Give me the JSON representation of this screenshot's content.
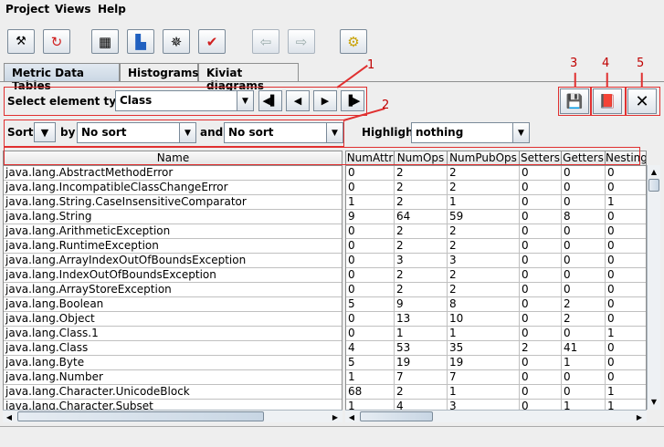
{
  "menu": {
    "items": [
      "Project",
      "Views",
      "Help"
    ]
  },
  "tabs": [
    "Metric Data Tables",
    "Histograms",
    "Kiviat diagrams"
  ],
  "select": {
    "label": "Select element type",
    "value": "Class"
  },
  "sort": {
    "label": "Sort",
    "by_label": "by",
    "and_label": "and",
    "primary": "No sort",
    "secondary": "No sort"
  },
  "highlight": {
    "label": "Highlight",
    "value": "nothing"
  },
  "annotations": [
    "1",
    "2",
    "3",
    "4",
    "5"
  ],
  "left_table": {
    "header": "Name",
    "rows": [
      "java.lang.AbstractMethodError",
      "java.lang.IncompatibleClassChangeError",
      "java.lang.String.CaseInsensitiveComparator",
      "java.lang.String",
      "java.lang.ArithmeticException",
      "java.lang.RuntimeException",
      "java.lang.ArrayIndexOutOfBoundsException",
      "java.lang.IndexOutOfBoundsException",
      "java.lang.ArrayStoreException",
      "java.lang.Boolean",
      "java.lang.Object",
      "java.lang.Class.1",
      "java.lang.Class",
      "java.lang.Byte",
      "java.lang.Number",
      "java.lang.Character.UnicodeBlock",
      "java.lang.Character.Subset"
    ]
  },
  "right_table": {
    "columns": [
      "NumAttr",
      "NumOps",
      "NumPubOps",
      "Setters",
      "Getters",
      "Nesting"
    ],
    "rows": [
      [
        "0",
        "2",
        "2",
        "0",
        "0",
        "0"
      ],
      [
        "0",
        "2",
        "2",
        "0",
        "0",
        "0"
      ],
      [
        "1",
        "2",
        "1",
        "0",
        "0",
        "1"
      ],
      [
        "9",
        "64",
        "59",
        "0",
        "8",
        "0"
      ],
      [
        "0",
        "2",
        "2",
        "0",
        "0",
        "0"
      ],
      [
        "0",
        "2",
        "2",
        "0",
        "0",
        "0"
      ],
      [
        "0",
        "3",
        "3",
        "0",
        "0",
        "0"
      ],
      [
        "0",
        "2",
        "2",
        "0",
        "0",
        "0"
      ],
      [
        "0",
        "2",
        "2",
        "0",
        "0",
        "0"
      ],
      [
        "5",
        "9",
        "8",
        "0",
        "2",
        "0"
      ],
      [
        "0",
        "13",
        "10",
        "0",
        "2",
        "0"
      ],
      [
        "0",
        "1",
        "1",
        "0",
        "0",
        "1"
      ],
      [
        "4",
        "53",
        "35",
        "2",
        "41",
        "0"
      ],
      [
        "5",
        "19",
        "19",
        "0",
        "1",
        "0"
      ],
      [
        "1",
        "7",
        "7",
        "0",
        "0",
        "0"
      ],
      [
        "68",
        "2",
        "1",
        "0",
        "0",
        "1"
      ],
      [
        "1",
        "4",
        "3",
        "0",
        "1",
        "1"
      ]
    ]
  },
  "colors": {
    "annotation": "#e03030",
    "tab_selected": "#c9d6e3",
    "border": "#7a8a99"
  }
}
